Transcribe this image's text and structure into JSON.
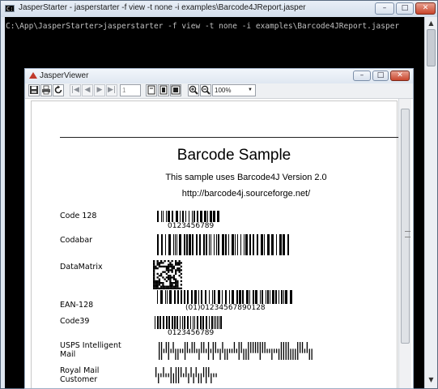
{
  "console": {
    "title": "JasperStarter - jasperstarter  -f view -t none -i examples\\Barcode4JReport.jasper",
    "icon_text": "C:\\",
    "command_line": "C:\\App\\JasperStarter>jasperstarter -f view -t none -i examples\\Barcode4JReport.jasper",
    "buttons": {
      "minimize": "–",
      "maximize": "□",
      "close": "✕"
    },
    "scroll": {
      "up": "▲",
      "down": "▼"
    }
  },
  "viewer": {
    "title": "JasperViewer",
    "buttons": {
      "minimize": "–",
      "maximize": "□",
      "close": "✕"
    },
    "toolbar": {
      "page_number": "1",
      "zoom": "100%",
      "dropdown": "▼",
      "nav_first": "|◀",
      "nav_prev": "◀",
      "nav_next": "▶",
      "nav_last": "▶|",
      "zoom_in": "+",
      "zoom_out": "−"
    },
    "report": {
      "title": "Barcode Sample",
      "subtitle": "This sample uses Barcode4J Version 2.0",
      "url": "http://barcode4j.sourceforge.net/",
      "rows": [
        {
          "label": "Code 128",
          "text": "0123456789"
        },
        {
          "label": "Codabar",
          "text": ""
        },
        {
          "label": "DataMatrix",
          "text": ""
        },
        {
          "label": "EAN-128",
          "text": "(01)01234567890128"
        },
        {
          "label": "Code39",
          "text": "0123456789"
        },
        {
          "label": "USPS Intelligent Mail",
          "text": ""
        },
        {
          "label": "Royal Mail Customer",
          "text": ""
        }
      ]
    }
  }
}
